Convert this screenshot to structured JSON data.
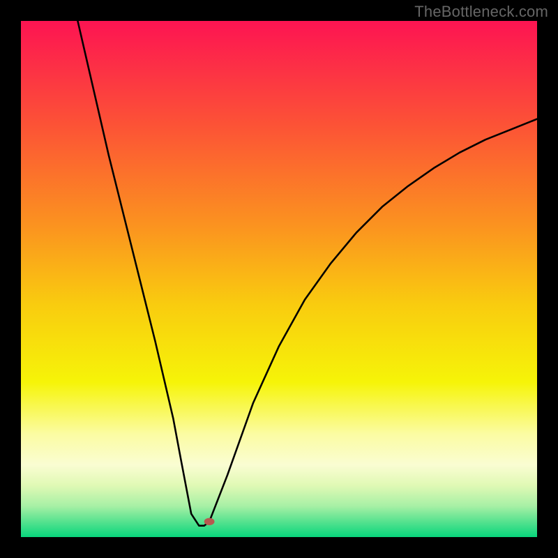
{
  "watermark": {
    "text": "TheBottleneck.com"
  },
  "chart_data": {
    "type": "line",
    "title": "",
    "xlabel": "",
    "ylabel": "",
    "xlim": [
      0,
      100
    ],
    "ylim": [
      0,
      100
    ],
    "legend": false,
    "grid": false,
    "series": [
      {
        "name": "curve",
        "x": [
          11,
          14,
          17,
          20,
          23,
          26,
          29.5,
          31,
          33,
          34.5,
          35.5,
          36.5,
          40,
          45,
          50,
          55,
          60,
          65,
          70,
          75,
          80,
          85,
          90,
          95,
          100
        ],
        "y": [
          100,
          87,
          74,
          62,
          50,
          38,
          23,
          15,
          4.5,
          2.2,
          2.2,
          3,
          12,
          26,
          37,
          46,
          53,
          59,
          64,
          68,
          71.5,
          74.5,
          77,
          79,
          81
        ]
      }
    ],
    "marker": {
      "x": 36.5,
      "y": 3,
      "r": 1,
      "color": "#b7584f"
    },
    "background_gradient": {
      "stops": [
        {
          "offset": 0,
          "color": "#fd1452"
        },
        {
          "offset": 20,
          "color": "#fc5236"
        },
        {
          "offset": 40,
          "color": "#fb941f"
        },
        {
          "offset": 55,
          "color": "#f9cc0f"
        },
        {
          "offset": 70,
          "color": "#f6f408"
        },
        {
          "offset": 80,
          "color": "#fbfca2"
        },
        {
          "offset": 86,
          "color": "#fafdd2"
        },
        {
          "offset": 90,
          "color": "#e0f9b5"
        },
        {
          "offset": 94,
          "color": "#a7f0a5"
        },
        {
          "offset": 97,
          "color": "#56e28f"
        },
        {
          "offset": 100,
          "color": "#08d67c"
        }
      ]
    }
  }
}
